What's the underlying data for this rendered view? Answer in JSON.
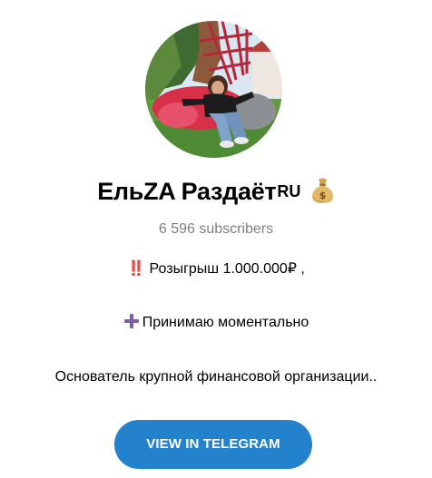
{
  "channel": {
    "title": "ЕльZA Раздаёт",
    "title_suffix": "RU",
    "title_emoji_icon": "money-bag-icon",
    "subscribers": "6 596 subscribers",
    "description": {
      "line1": "‼️ Розыгрыш 1.000.000₽ ,",
      "line2_icon": "heavy-plus-icon",
      "line2": "Принимаю моментально",
      "line3": "Основатель крупной финансовой организации.."
    }
  },
  "cta": {
    "label": "VIEW IN TELEGRAM"
  },
  "colors": {
    "accent": "#2481cc",
    "muted_text": "#7d7f81",
    "plus_icon": "#7a5ea8"
  }
}
